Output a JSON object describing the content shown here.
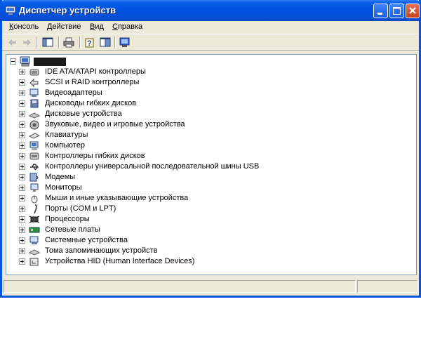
{
  "window": {
    "title": "Диспетчер устройств"
  },
  "menu": [
    {
      "hotkey": "К",
      "rest": "онсоль"
    },
    {
      "hotkey": "Д",
      "rest": "ействие"
    },
    {
      "hotkey": "В",
      "rest": "ид"
    },
    {
      "hotkey": "С",
      "rest": "правка"
    }
  ],
  "toolbar": [
    "back-icon",
    "forward-icon",
    "show-hide-tree-icon",
    "print-icon",
    "help-icon",
    "properties-icon",
    "scan-hardware-icon"
  ],
  "tree": {
    "root_icon": "computer-icon",
    "categories": [
      {
        "label": "IDE ATA/ATAPI контроллеры",
        "icon": "ide-controller-icon"
      },
      {
        "label": "SCSI и RAID контроллеры",
        "icon": "scsi-controller-icon"
      },
      {
        "label": "Видеоадаптеры",
        "icon": "display-adapter-icon"
      },
      {
        "label": "Дисководы гибких дисков",
        "icon": "floppy-drive-icon"
      },
      {
        "label": "Дисковые устройства",
        "icon": "disk-drive-icon"
      },
      {
        "label": "Звуковые, видео и игровые устройства",
        "icon": "sound-device-icon"
      },
      {
        "label": "Клавиатуры",
        "icon": "keyboard-icon"
      },
      {
        "label": "Компьютер",
        "icon": "computer-icon"
      },
      {
        "label": "Контроллеры гибких дисков",
        "icon": "floppy-controller-icon"
      },
      {
        "label": "Контроллеры универсальной последовательной шины USB",
        "icon": "usb-icon"
      },
      {
        "label": "Модемы",
        "icon": "modem-icon"
      },
      {
        "label": "Мониторы",
        "icon": "monitor-icon"
      },
      {
        "label": "Мыши и иные указывающие устройства",
        "icon": "mouse-icon"
      },
      {
        "label": "Порты (COM и LPT)",
        "icon": "port-icon"
      },
      {
        "label": "Процессоры",
        "icon": "processor-icon"
      },
      {
        "label": "Сетевые платы",
        "icon": "network-adapter-icon"
      },
      {
        "label": "Системные устройства",
        "icon": "system-device-icon"
      },
      {
        "label": "Тома запоминающих устройств",
        "icon": "storage-volume-icon"
      },
      {
        "label": "Устройства HID (Human Interface Devices)",
        "icon": "hid-icon"
      }
    ]
  },
  "colors": {
    "title_bar": "#0054e3",
    "window_bg": "#ece9d8",
    "content_bg": "#ffffff",
    "border": "#7f9db9"
  }
}
